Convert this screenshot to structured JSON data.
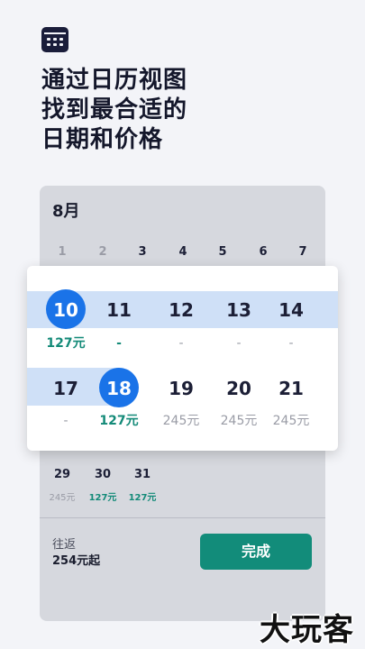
{
  "headline": [
    "通过日历视图",
    "找到最合适的",
    "日期和价格"
  ],
  "calendar": {
    "month": "8月",
    "week0": [
      "1",
      "2",
      "3",
      "4",
      "5",
      "6",
      "7"
    ],
    "week1": [
      {
        "day": "10",
        "price": "127元",
        "selected": true,
        "price_style": "teal"
      },
      {
        "day": "11",
        "price": "-",
        "price_style": "teal"
      },
      {
        "day": "12",
        "price": "-",
        "price_style": "grey"
      },
      {
        "day": "13",
        "price": "-",
        "price_style": "grey"
      },
      {
        "day": "14",
        "price": "-",
        "price_style": "grey"
      }
    ],
    "week2": [
      {
        "day": "17",
        "price": "-",
        "price_style": "grey"
      },
      {
        "day": "18",
        "price": "127元",
        "selected": true,
        "price_style": "teal"
      },
      {
        "day": "19",
        "price": "245元",
        "price_style": "grey"
      },
      {
        "day": "20",
        "price": "245元",
        "price_style": "grey"
      },
      {
        "day": "21",
        "price": "245元",
        "price_style": "grey"
      }
    ],
    "week3": [
      {
        "day": "29",
        "price": "245元",
        "price_style": "grey"
      },
      {
        "day": "30",
        "price": "127元",
        "price_style": "teal"
      },
      {
        "day": "31",
        "price": "127元",
        "price_style": "teal"
      }
    ]
  },
  "footer": {
    "trip_type": "往返",
    "price_from": "254元起",
    "done_label": "完成"
  },
  "watermark": "大玩客",
  "colors": {
    "accent_blue": "#1a73e8",
    "teal": "#138a78",
    "band": "#cfe0f7",
    "button": "#128c7a"
  },
  "icons": {
    "app": "calendar-icon"
  }
}
